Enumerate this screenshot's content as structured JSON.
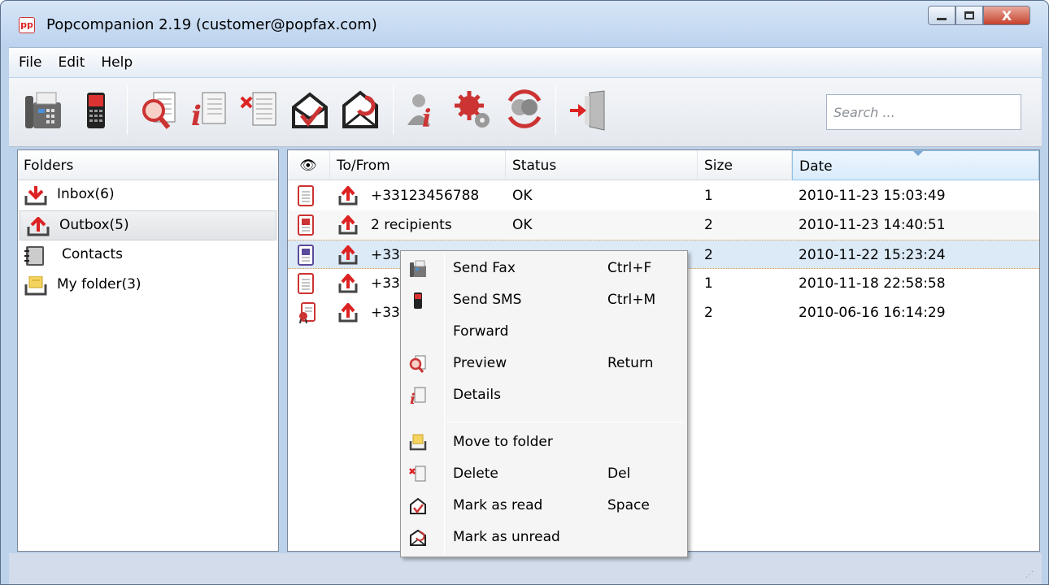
{
  "window": {
    "title": "Popcompanion 2.19 (customer@popfax.com)",
    "app_icon_text": "pp",
    "close_label": "X"
  },
  "menu": [
    "File",
    "Edit",
    "Help"
  ],
  "toolbar": {
    "buttons": [
      "send-fax-icon",
      "send-sms-icon",
      "preview-icon",
      "details-icon",
      "delete-icon",
      "mark-read-icon",
      "mark-unread-icon",
      "user-info-icon",
      "settings-icon",
      "sync-icon",
      "exit-icon"
    ],
    "search_placeholder": "Search ..."
  },
  "folders": {
    "header": "Folders",
    "items": [
      {
        "label": "Inbox(6)",
        "icon": "inbox-icon"
      },
      {
        "label": "Outbox(5)",
        "icon": "outbox-icon",
        "selected": true
      },
      {
        "label": "Contacts",
        "icon": "contacts-icon"
      },
      {
        "label": "My folder(3)",
        "icon": "folder-icon"
      }
    ]
  },
  "messages": {
    "columns": {
      "read": "👁",
      "to_from": "To/From",
      "status": "Status",
      "size": "Size",
      "date": "Date"
    },
    "rows": [
      {
        "to_from": "+33123456788",
        "status": "OK",
        "size": "1",
        "date": "2010-11-23 15:03:49"
      },
      {
        "to_from": "2 recipients",
        "status": "OK",
        "size": "2",
        "date": "2010-11-23 14:40:51"
      },
      {
        "to_from": "+33",
        "status": "",
        "size": "2",
        "date": "2010-11-22 15:23:24"
      },
      {
        "to_from": "+33",
        "status": "",
        "size": "1",
        "date": "2010-11-18 22:58:58"
      },
      {
        "to_from": "+33",
        "status": "",
        "size": "2",
        "date": "2010-06-16 16:14:29"
      }
    ]
  },
  "context_menu": {
    "items": [
      {
        "label": "Send Fax",
        "shortcut": "Ctrl+F",
        "icon": "fax-icon"
      },
      {
        "label": "Send SMS",
        "shortcut": "Ctrl+M",
        "icon": "mobile-icon"
      },
      {
        "label": "Forward",
        "shortcut": "",
        "icon": ""
      },
      {
        "label": "Preview",
        "shortcut": "Return",
        "icon": "magnifier-icon"
      },
      {
        "label": "Details",
        "shortcut": "",
        "icon": "details-icon"
      },
      {
        "label": "Move to folder",
        "shortcut": "",
        "icon": "folder-icon"
      },
      {
        "label": "Delete",
        "shortcut": "Del",
        "icon": "delete-icon"
      },
      {
        "label": "Mark as read",
        "shortcut": "Space",
        "icon": "envelope-open-icon"
      },
      {
        "label": "Mark as unread",
        "shortcut": "",
        "icon": "envelope-closed-icon"
      }
    ]
  }
}
